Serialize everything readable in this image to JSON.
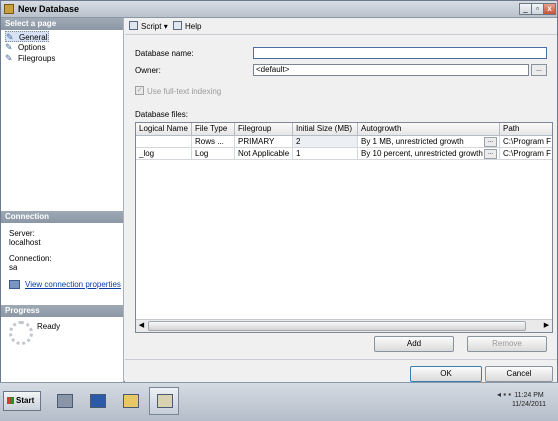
{
  "window": {
    "title": "New Database",
    "controls": [
      "_",
      "▫",
      "x"
    ]
  },
  "left": {
    "select_page_header": "Select a page",
    "pages": [
      {
        "label": "General",
        "selected": true
      },
      {
        "label": "Options",
        "selected": false
      },
      {
        "label": "Filegroups",
        "selected": false
      }
    ],
    "connection_header": "Connection",
    "server_label": "Server:",
    "server_value": "localhost",
    "connection_label": "Connection:",
    "connection_value": "sa",
    "view_connection_link": "View connection properties",
    "progress_header": "Progress",
    "progress_status": "Ready"
  },
  "toolbar": {
    "script_label": "Script",
    "help_label": "Help"
  },
  "form": {
    "database_name_label": "Database name:",
    "database_name_value": "",
    "owner_label": "Owner:",
    "owner_value": "<default>",
    "browse_label": "...",
    "fulltext_label": "Use full-text indexing",
    "database_files_label": "Database files:"
  },
  "grid": {
    "columns": [
      "Logical Name",
      "File Type",
      "Filegroup",
      "Initial Size (MB)",
      "Autogrowth",
      "Path"
    ],
    "rows": [
      {
        "logical_name": "",
        "file_type": "Rows ...",
        "filegroup": "PRIMARY",
        "initial_size": "2",
        "autogrowth": "By 1 MB, unrestricted growth",
        "path": "C:\\Program F"
      },
      {
        "logical_name": "_log",
        "file_type": "Log",
        "filegroup": "Not Applicable",
        "initial_size": "1",
        "autogrowth": "By 10 percent, unrestricted growth",
        "path": "C:\\Program F"
      }
    ],
    "cell_button": "..."
  },
  "buttons": {
    "add": "Add",
    "remove": "Remove",
    "ok": "OK",
    "cancel": "Cancel"
  },
  "taskbar": {
    "start_label": "Start",
    "clock_time": "11:24 PM",
    "clock_date": "11/24/2011"
  }
}
